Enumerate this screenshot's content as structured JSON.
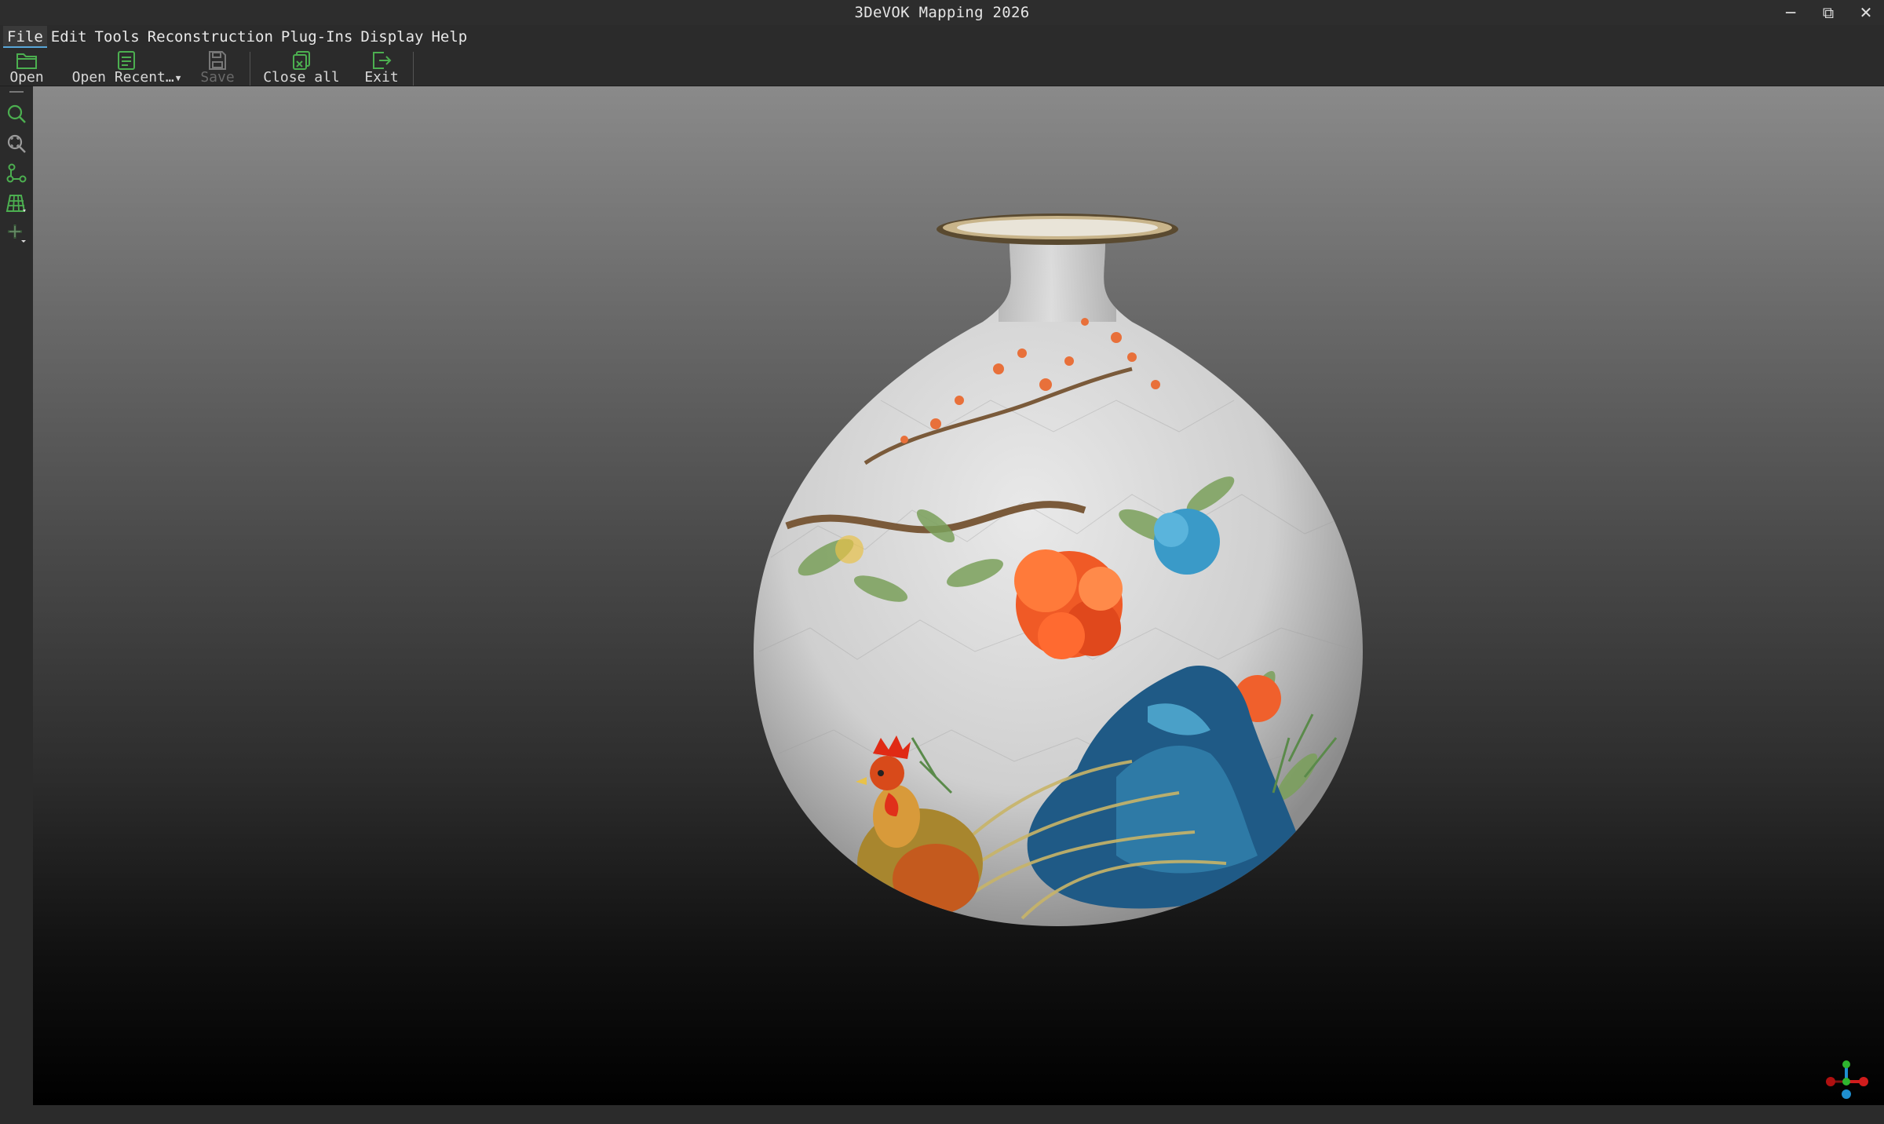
{
  "window": {
    "title": "3DeVOK Mapping 2026",
    "controls": {
      "minimize": "─",
      "maximize": "⧉",
      "close": "✕"
    }
  },
  "menu": {
    "items": [
      "File",
      "Edit",
      "Tools",
      "Reconstruction",
      "Plug-Ins",
      "Display",
      "Help"
    ],
    "active": "File"
  },
  "toolbar": {
    "open": "Open",
    "open_recent": "Open Recent…",
    "save": "Save",
    "close_all": "Close all",
    "exit": "Exit"
  },
  "sidebar": {
    "icons": [
      "zoom-icon",
      "zoom-fit-icon",
      "node-graph-icon",
      "grid-select-icon",
      "move-dropdown-icon"
    ]
  },
  "viewport": {
    "model": "porcelain vase",
    "axis_colors": {
      "x": "#d01c1c",
      "y": "#2fb52f",
      "z": "#1f8fd0"
    }
  }
}
